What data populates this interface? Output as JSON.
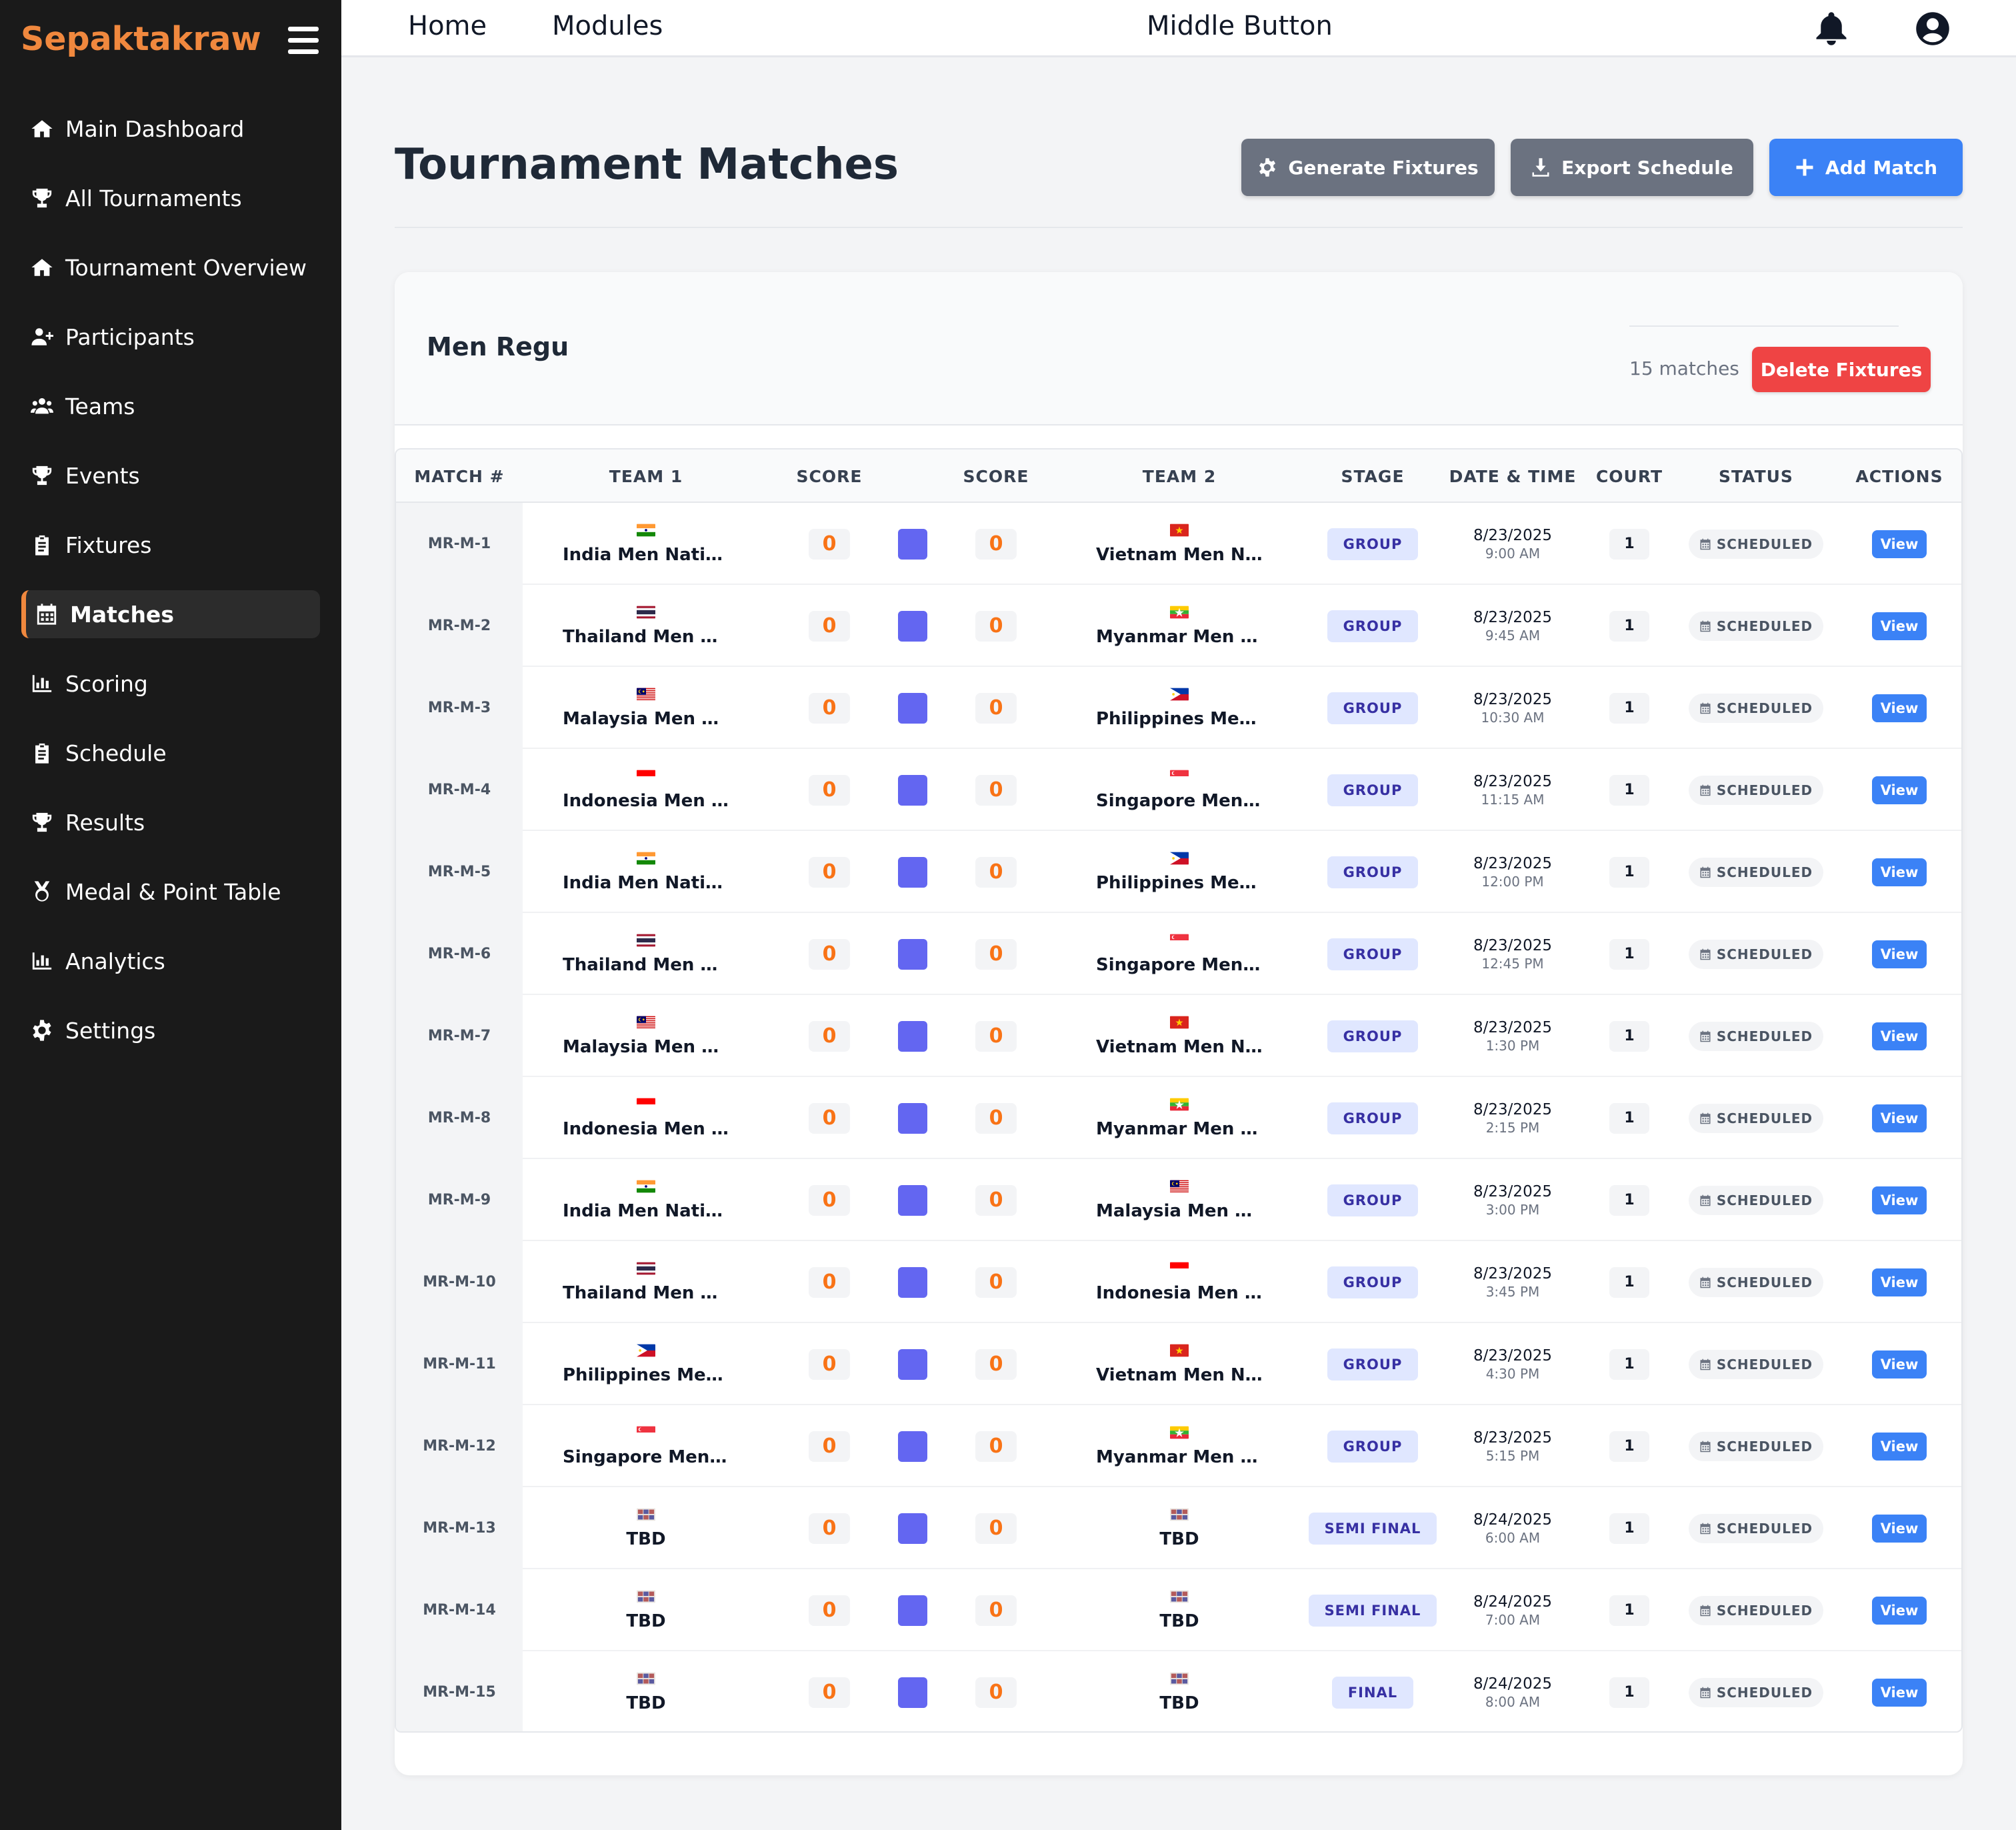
{
  "brand": "Sepaktakraw",
  "sidebar": {
    "items": [
      {
        "label": "Main Dashboard",
        "icon": "home-icon"
      },
      {
        "label": "All Tournaments",
        "icon": "trophy-icon"
      },
      {
        "label": "Tournament Overview",
        "icon": "home-icon"
      },
      {
        "label": "Participants",
        "icon": "user-plus-icon"
      },
      {
        "label": "Teams",
        "icon": "users-icon"
      },
      {
        "label": "Events",
        "icon": "trophy-icon"
      },
      {
        "label": "Fixtures",
        "icon": "clipboard-icon"
      },
      {
        "label": "Matches",
        "icon": "calendar-icon",
        "active": true
      },
      {
        "label": "Scoring",
        "icon": "bar-chart-icon"
      },
      {
        "label": "Schedule",
        "icon": "clipboard-icon"
      },
      {
        "label": "Results",
        "icon": "trophy-icon"
      },
      {
        "label": "Medal & Point Table",
        "icon": "medal-icon"
      },
      {
        "label": "Analytics",
        "icon": "bar-chart-icon"
      },
      {
        "label": "Settings",
        "icon": "gear-icon"
      }
    ]
  },
  "topbar": {
    "home": "Home",
    "modules": "Modules",
    "middle": "Middle Button",
    "icons": [
      "bell-icon",
      "user-circle-icon"
    ]
  },
  "page": {
    "title": "Tournament Matches",
    "generate": "Generate Fixtures",
    "export": "Export Schedule",
    "add": "Add Match"
  },
  "event": {
    "name": "Men Regu",
    "count": "15 matches",
    "delete": "Delete Fixtures"
  },
  "colors": {
    "accent": "#f0883e",
    "primary": "#3b82f6",
    "danger": "#ef4444",
    "gray_button": "#6b7280",
    "score": "#f97316",
    "indigo": "#6366f1"
  },
  "table": {
    "headers": {
      "match": "MATCH #",
      "team1": "TEAM 1",
      "score1": "SCORE",
      "score2": "SCORE",
      "team2": "TEAM 2",
      "stage": "STAGE",
      "datetime": "DATE & TIME",
      "court": "COURT",
      "status": "STATUS",
      "actions": "ACTIONS"
    },
    "rows": [
      {
        "id": "MR-M-1",
        "team1": "India Men Nation...",
        "flag1": "india",
        "s1": "0",
        "s2": "0",
        "team2": "Vietnam Men Nati...",
        "flag2": "vietnam",
        "stage": "GROUP",
        "date": "8/23/2025",
        "time": "9:00 AM",
        "court": "1",
        "status": "SCHEDULED",
        "action": "View"
      },
      {
        "id": "MR-M-2",
        "team1": "Thailand Men Nat...",
        "flag1": "thailand",
        "s1": "0",
        "s2": "0",
        "team2": "Myanmar Men Na...",
        "flag2": "myanmar",
        "stage": "GROUP",
        "date": "8/23/2025",
        "time": "9:45 AM",
        "court": "1",
        "status": "SCHEDULED",
        "action": "View"
      },
      {
        "id": "MR-M-3",
        "team1": "Malaysia Men Nat...",
        "flag1": "malaysia",
        "s1": "0",
        "s2": "0",
        "team2": "Philippines Men N...",
        "flag2": "philippines",
        "stage": "GROUP",
        "date": "8/23/2025",
        "time": "10:30 AM",
        "court": "1",
        "status": "SCHEDULED",
        "action": "View"
      },
      {
        "id": "MR-M-4",
        "team1": "Indonesia Men Na...",
        "flag1": "indonesia",
        "s1": "0",
        "s2": "0",
        "team2": "Singapore Men N...",
        "flag2": "singapore",
        "stage": "GROUP",
        "date": "8/23/2025",
        "time": "11:15 AM",
        "court": "1",
        "status": "SCHEDULED",
        "action": "View"
      },
      {
        "id": "MR-M-5",
        "team1": "India Men Nation...",
        "flag1": "india",
        "s1": "0",
        "s2": "0",
        "team2": "Philippines Men N...",
        "flag2": "philippines",
        "stage": "GROUP",
        "date": "8/23/2025",
        "time": "12:00 PM",
        "court": "1",
        "status": "SCHEDULED",
        "action": "View"
      },
      {
        "id": "MR-M-6",
        "team1": "Thailand Men Nat...",
        "flag1": "thailand",
        "s1": "0",
        "s2": "0",
        "team2": "Singapore Men N...",
        "flag2": "singapore",
        "stage": "GROUP",
        "date": "8/23/2025",
        "time": "12:45 PM",
        "court": "1",
        "status": "SCHEDULED",
        "action": "View"
      },
      {
        "id": "MR-M-7",
        "team1": "Malaysia Men Nat...",
        "flag1": "malaysia",
        "s1": "0",
        "s2": "0",
        "team2": "Vietnam Men Nati...",
        "flag2": "vietnam",
        "stage": "GROUP",
        "date": "8/23/2025",
        "time": "1:30 PM",
        "court": "1",
        "status": "SCHEDULED",
        "action": "View"
      },
      {
        "id": "MR-M-8",
        "team1": "Indonesia Men Na...",
        "flag1": "indonesia",
        "s1": "0",
        "s2": "0",
        "team2": "Myanmar Men Na...",
        "flag2": "myanmar",
        "stage": "GROUP",
        "date": "8/23/2025",
        "time": "2:15 PM",
        "court": "1",
        "status": "SCHEDULED",
        "action": "View"
      },
      {
        "id": "MR-M-9",
        "team1": "India Men Nation...",
        "flag1": "india",
        "s1": "0",
        "s2": "0",
        "team2": "Malaysia Men Nat...",
        "flag2": "malaysia",
        "stage": "GROUP",
        "date": "8/23/2025",
        "time": "3:00 PM",
        "court": "1",
        "status": "SCHEDULED",
        "action": "View"
      },
      {
        "id": "MR-M-10",
        "team1": "Thailand Men Nat...",
        "flag1": "thailand",
        "s1": "0",
        "s2": "0",
        "team2": "Indonesia Men Na...",
        "flag2": "indonesia",
        "stage": "GROUP",
        "date": "8/23/2025",
        "time": "3:45 PM",
        "court": "1",
        "status": "SCHEDULED",
        "action": "View"
      },
      {
        "id": "MR-M-11",
        "team1": "Philippines Men N...",
        "flag1": "philippines",
        "s1": "0",
        "s2": "0",
        "team2": "Vietnam Men Nati...",
        "flag2": "vietnam",
        "stage": "GROUP",
        "date": "8/23/2025",
        "time": "4:30 PM",
        "court": "1",
        "status": "SCHEDULED",
        "action": "View"
      },
      {
        "id": "MR-M-12",
        "team1": "Singapore Men N...",
        "flag1": "singapore",
        "s1": "0",
        "s2": "0",
        "team2": "Myanmar Men Na...",
        "flag2": "myanmar",
        "stage": "GROUP",
        "date": "8/23/2025",
        "time": "5:15 PM",
        "court": "1",
        "status": "SCHEDULED",
        "action": "View"
      },
      {
        "id": "MR-M-13",
        "team1": "TBD",
        "flag1": "tbd",
        "s1": "0",
        "s2": "0",
        "team2": "TBD",
        "flag2": "tbd",
        "stage": "SEMI FINAL",
        "date": "8/24/2025",
        "time": "6:00 AM",
        "court": "1",
        "status": "SCHEDULED",
        "action": "View"
      },
      {
        "id": "MR-M-14",
        "team1": "TBD",
        "flag1": "tbd",
        "s1": "0",
        "s2": "0",
        "team2": "TBD",
        "flag2": "tbd",
        "stage": "SEMI FINAL",
        "date": "8/24/2025",
        "time": "7:00 AM",
        "court": "1",
        "status": "SCHEDULED",
        "action": "View"
      },
      {
        "id": "MR-M-15",
        "team1": "TBD",
        "flag1": "tbd",
        "s1": "0",
        "s2": "0",
        "team2": "TBD",
        "flag2": "tbd",
        "stage": "FINAL",
        "date": "8/24/2025",
        "time": "8:00 AM",
        "court": "1",
        "status": "SCHEDULED",
        "action": "View"
      }
    ]
  }
}
